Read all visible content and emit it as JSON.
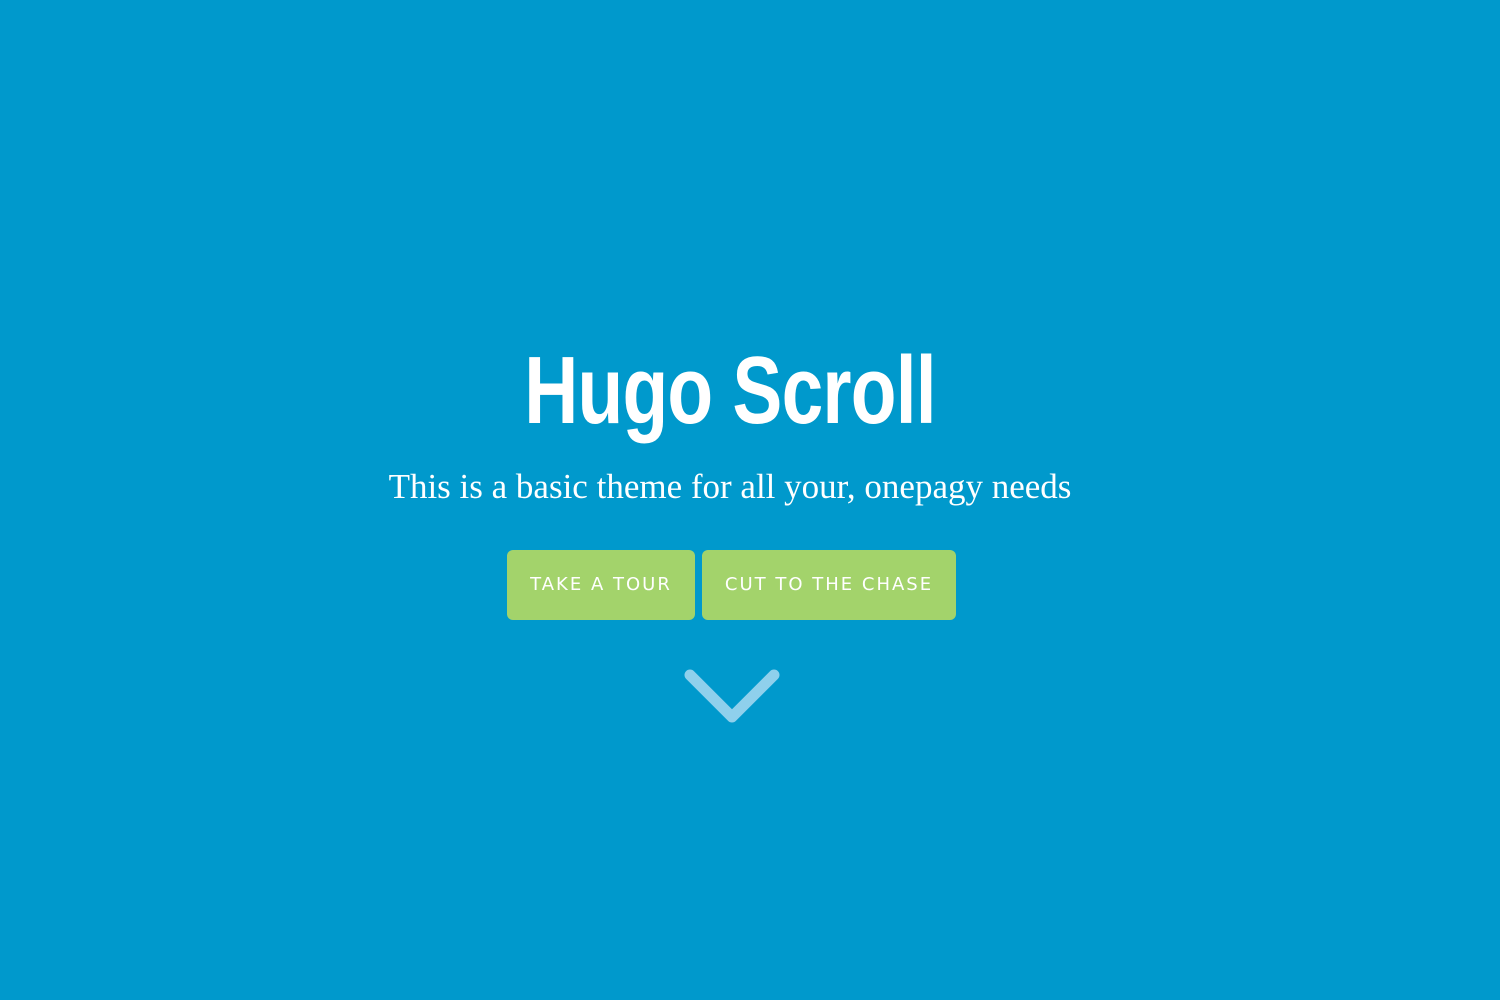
{
  "hero": {
    "title": "Hugo Scroll",
    "subtitle": "This is a basic theme for all your, onepagy needs",
    "buttons": {
      "tour_label": "TAKE A TOUR",
      "chase_label": "CUT TO THE CHASE"
    },
    "scroll_icon": "chevron-down-icon"
  },
  "colors": {
    "background": "#0099cc",
    "button": "#a3d36b",
    "text": "#ffffff",
    "chevron": "#8fd0ec"
  }
}
